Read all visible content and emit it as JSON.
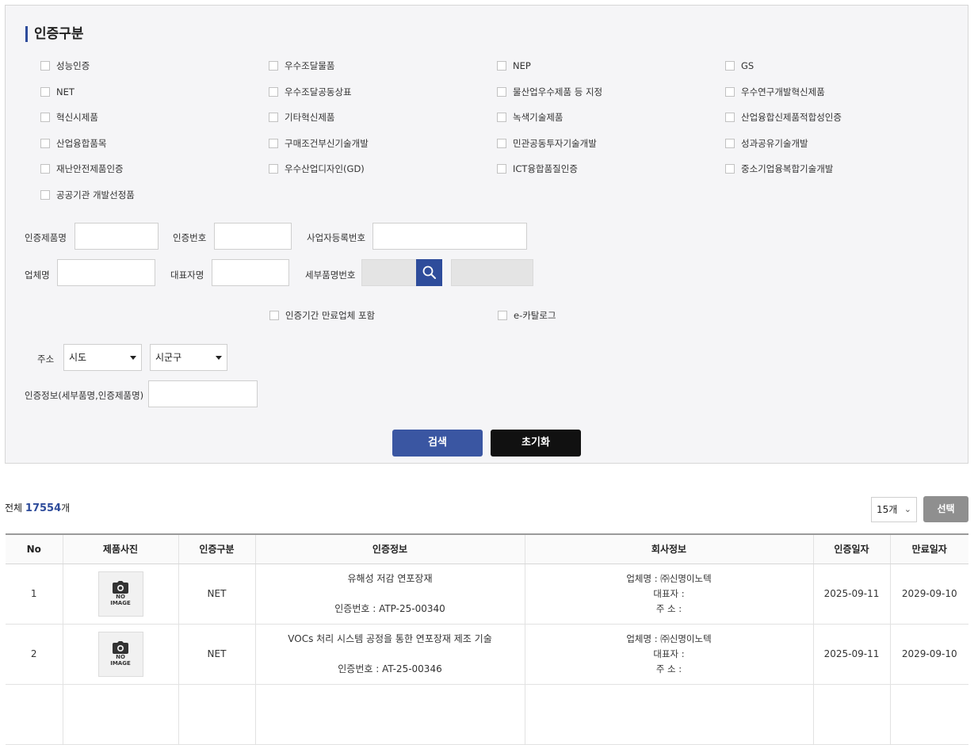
{
  "filter": {
    "title": "인증구분",
    "categories": [
      [
        "성능인증",
        "우수조달물품",
        "NEP",
        "GS"
      ],
      [
        "NET",
        "우수조달공동상표",
        "물산업우수제품 등 지정",
        "우수연구개발혁신제품"
      ],
      [
        "혁신시제품",
        "기타혁신제품",
        "녹색기술제품",
        "산업융합신제품적합성인증"
      ],
      [
        "산업융합품목",
        "구매조건부신기술개발",
        "민관공동투자기술개발",
        "성과공유기술개발"
      ],
      [
        "재난안전제품인증",
        "우수산업디자인(GD)",
        "ICT융합품질인증",
        "중소기업융복합기술개발"
      ],
      [
        "공공기관 개발선정품"
      ]
    ],
    "fields": {
      "product_name": "인증제품명",
      "cert_no": "인증번호",
      "biz_reg_no": "사업자등록번호",
      "company": "업체명",
      "ceo": "대표자명",
      "detail_item_no": "세부품명번호"
    },
    "options": {
      "expired": "인증기간 만료업체 포함",
      "ecatalog": "e-카탈로그"
    },
    "address": {
      "label": "주소",
      "sido": "시도",
      "sigungu": "시군구"
    },
    "cert_info_label": "인증정보(세부품명,인증제품명)",
    "search_button": "검색",
    "reset_button": "초기화"
  },
  "results": {
    "total_prefix": "전체",
    "total_count": "17554",
    "total_suffix": "개",
    "per_page": "15개",
    "select_button": "선택",
    "columns": [
      "No",
      "제품사진",
      "인증구분",
      "인증정보",
      "회사정보",
      "인증일자",
      "만료일자"
    ],
    "no_image": {
      "line1": "NO",
      "line2": "IMAGE"
    },
    "rows": [
      {
        "no": "1",
        "category": "NET",
        "title": "유해성 저감 연포장재",
        "cert_no": "인증번호 : ATP-25-00340",
        "company": "업체명 : ㈜신명이노텍",
        "ceo": "대표자 :",
        "address": "주  소 :",
        "cert_date": "2025-09-11",
        "expire_date": "2029-09-10"
      },
      {
        "no": "2",
        "category": "NET",
        "title": "VOCs 처리 시스템 공정을 통한 연포장재 제조 기술",
        "cert_no": "인증번호 : AT-25-00346",
        "company": "업체명 : ㈜신명이노텍",
        "ceo": "대표자 :",
        "address": "주  소 :",
        "cert_date": "2025-09-11",
        "expire_date": "2029-09-10"
      },
      {
        "no": "",
        "category": "",
        "title": "",
        "cert_no": "",
        "company": "",
        "ceo": "",
        "address": "",
        "cert_date": "",
        "expire_date": ""
      }
    ]
  },
  "colors": {
    "accent": "#2e4c9b",
    "search_button": "#3a56a2",
    "reset_button": "#111111",
    "panel_bg": "#f5f5f7"
  }
}
